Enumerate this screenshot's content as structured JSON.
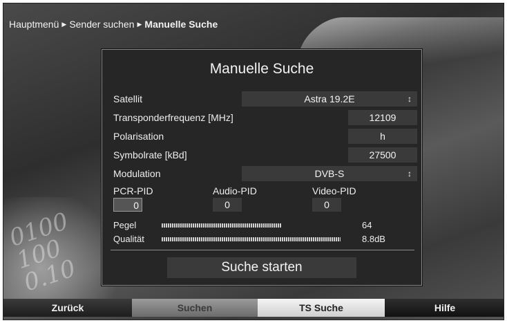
{
  "breadcrumb": {
    "items": [
      "Hauptmenü",
      "Sender suchen"
    ],
    "current": "Manuelle Suche"
  },
  "background": {
    "digits": "0100\n100\n0.10"
  },
  "dialog": {
    "title": "Manuelle Suche",
    "fields": {
      "satellit": {
        "label": "Satellit",
        "value": "Astra 19.2E"
      },
      "transponder": {
        "label": "Transponderfrequenz [MHz]",
        "value": "12109"
      },
      "polarisation": {
        "label": "Polarisation",
        "value": "h"
      },
      "symbolrate": {
        "label": "Symbolrate [kBd]",
        "value": "27500"
      },
      "modulation": {
        "label": "Modulation",
        "value": "DVB-S"
      }
    },
    "pids": {
      "pcr": {
        "label": "PCR-PID",
        "value": "0"
      },
      "audio": {
        "label": "Audio-PID",
        "value": "0"
      },
      "video": {
        "label": "Video-PID",
        "value": "0"
      }
    },
    "meters": {
      "pegel": {
        "label": "Pegel",
        "value": "64",
        "level": 0.64
      },
      "qualitaet": {
        "label": "Qualität",
        "value": "8.8dB",
        "level": 0.96
      }
    },
    "start_button": "Suche starten"
  },
  "footer": {
    "red": "Zurück",
    "green": "Suchen",
    "yellow": "TS Suche",
    "blue": "Hilfe"
  },
  "icons": {
    "breadcrumb_separator": "triangle-right-icon",
    "select_arrow": "up-down-arrow-icon"
  }
}
